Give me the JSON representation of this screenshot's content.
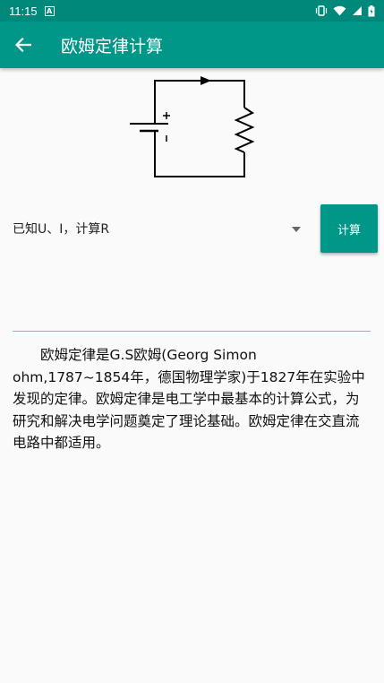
{
  "status": {
    "time": "11:15",
    "notif_letter": "A"
  },
  "app_bar": {
    "title": "欧姆定律计算"
  },
  "form": {
    "mode_selected": "已知U、I，计算R",
    "calc_label": "计算",
    "result_value": ""
  },
  "description": "欧姆定律是G.S欧姆(Georg Simon ohm,1787~1854年，德国物理学家)于1827年在实验中发现的定律。欧姆定律是电工学中最基本的计算公式，为研究和解决电学问题奠定了理论基础。欧姆定律在交直流电路中都适用。",
  "colors": {
    "primary": "#009688",
    "primary_dark": "#00897b",
    "underline": "#80b3c4"
  }
}
